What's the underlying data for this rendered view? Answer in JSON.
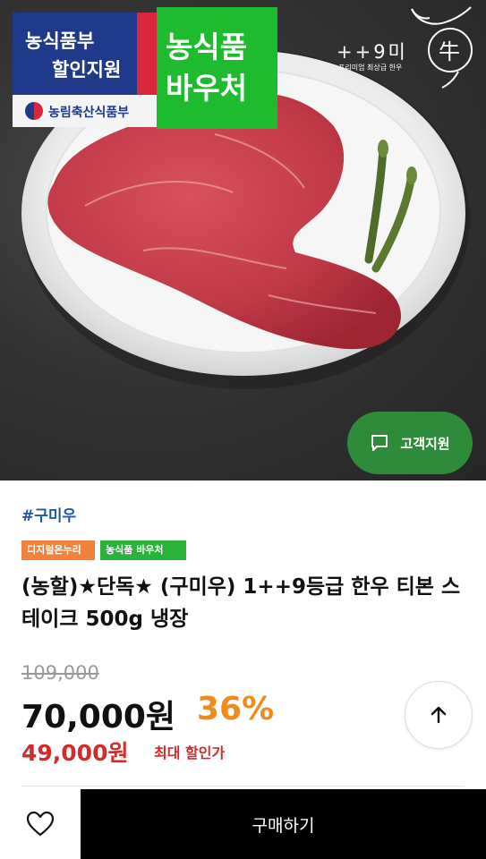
{
  "hero": {
    "gov_badge": {
      "line1": "농식품부",
      "line2": "할인지원",
      "ministry": "농림축산식품부"
    },
    "voucher_badge": {
      "line1": "농식품",
      "line2": "바우처"
    },
    "brand": {
      "logo_text": "++9미",
      "tagline": "프리미엄 최상급 한우"
    },
    "support_button": {
      "label": "고객지원",
      "icon": "chat-bubble-icon"
    }
  },
  "product": {
    "hashtag": "#구미우",
    "tags": [
      "디지털온누리",
      "농식품 바우처"
    ],
    "title": "(농할)★단독★ (구미우) 1++9등급 한우 티본 스테이크 500g 냉장",
    "original_price": "109,000",
    "sale_price": "70,000원",
    "discount": "36%",
    "max_discount_price": "49,000원",
    "max_discount_label": "최대 할인가"
  },
  "scroll_top_icon": "arrow-up-icon",
  "bottom_bar": {
    "wishlist_icon": "heart-icon",
    "buy_label": "구매하기"
  },
  "colors": {
    "gov_blue": "#1f3a8a",
    "voucher_green": "#1fbb2f",
    "support_green": "#2e8b3a",
    "hashtag_blue": "#1c5aa8",
    "discount_orange": "#f08a1c",
    "max_price_red": "#d42a2a"
  }
}
